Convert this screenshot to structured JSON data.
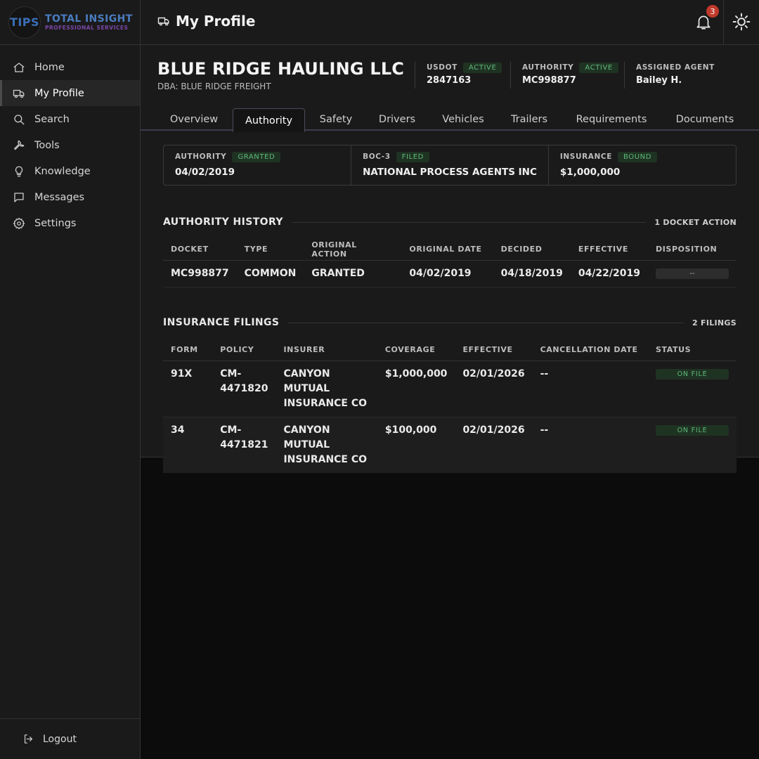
{
  "logo": {
    "mark": "TIPS",
    "line1": "TOTAL INSIGHT",
    "line2": "PROFESSIONAL SERVICES"
  },
  "sidebar": {
    "items": [
      {
        "label": "Home",
        "icon": "home-icon"
      },
      {
        "label": "My Profile",
        "icon": "truck-icon",
        "active": true
      },
      {
        "label": "Search",
        "icon": "search-icon"
      },
      {
        "label": "Tools",
        "icon": "wrench-icon"
      },
      {
        "label": "Knowledge",
        "icon": "lightbulb-icon"
      },
      {
        "label": "Messages",
        "icon": "message-icon"
      },
      {
        "label": "Settings",
        "icon": "gear-icon"
      }
    ],
    "logout_label": "Logout"
  },
  "header": {
    "title": "My Profile",
    "notification_count": "3"
  },
  "company": {
    "name": "BLUE RIDGE HAULING LLC",
    "dba": "DBA: BLUE RIDGE FREIGHT",
    "usdot": {
      "label": "USDOT",
      "status": "ACTIVE",
      "value": "2847163"
    },
    "authority": {
      "label": "AUTHORITY",
      "status": "ACTIVE",
      "value": "MC998877"
    },
    "agent": {
      "label": "ASSIGNED AGENT",
      "value": "Bailey H."
    }
  },
  "tabs": [
    "Overview",
    "Authority",
    "Safety",
    "Drivers",
    "Vehicles",
    "Trailers",
    "Requirements",
    "Documents"
  ],
  "active_tab": "Authority",
  "summary": [
    {
      "label": "AUTHORITY",
      "status": "GRANTED",
      "value": "04/02/2019"
    },
    {
      "label": "BOC-3",
      "status": "FILED",
      "value": "NATIONAL PROCESS AGENTS INC"
    },
    {
      "label": "INSURANCE",
      "status": "BOUND",
      "value": "$1,000,000"
    }
  ],
  "authority_history": {
    "title": "AUTHORITY HISTORY",
    "count": "1 DOCKET ACTION",
    "columns": [
      "DOCKET",
      "TYPE",
      "ORIGINAL ACTION",
      "ORIGINAL DATE",
      "DECIDED",
      "EFFECTIVE",
      "DISPOSITION"
    ],
    "rows": [
      {
        "docket": "MC998877",
        "type": "COMMON",
        "original_action": "GRANTED",
        "original_date": "04/02/2019",
        "decided": "04/18/2019",
        "effective": "04/22/2019",
        "disposition": "--"
      }
    ]
  },
  "insurance_filings": {
    "title": "INSURANCE FILINGS",
    "count": "2 FILINGS",
    "columns": [
      "FORM",
      "POLICY",
      "INSURER",
      "COVERAGE",
      "EFFECTIVE",
      "CANCELLATION DATE",
      "STATUS"
    ],
    "rows": [
      {
        "form": "91X",
        "policy": "CM-4471820",
        "insurer": "CANYON MUTUAL INSURANCE CO",
        "coverage": "$1,000,000",
        "effective": "02/01/2026",
        "cancellation": "--",
        "status": "ON FILE"
      },
      {
        "form": "34",
        "policy": "CM-4471821",
        "insurer": "CANYON MUTUAL INSURANCE CO",
        "coverage": "$100,000",
        "effective": "02/01/2026",
        "cancellation": "--",
        "status": "ON FILE"
      }
    ]
  },
  "colors": {
    "status_green": "#5fb97a",
    "status_bg": "#1f3323",
    "badge_red": "#c0392b"
  }
}
